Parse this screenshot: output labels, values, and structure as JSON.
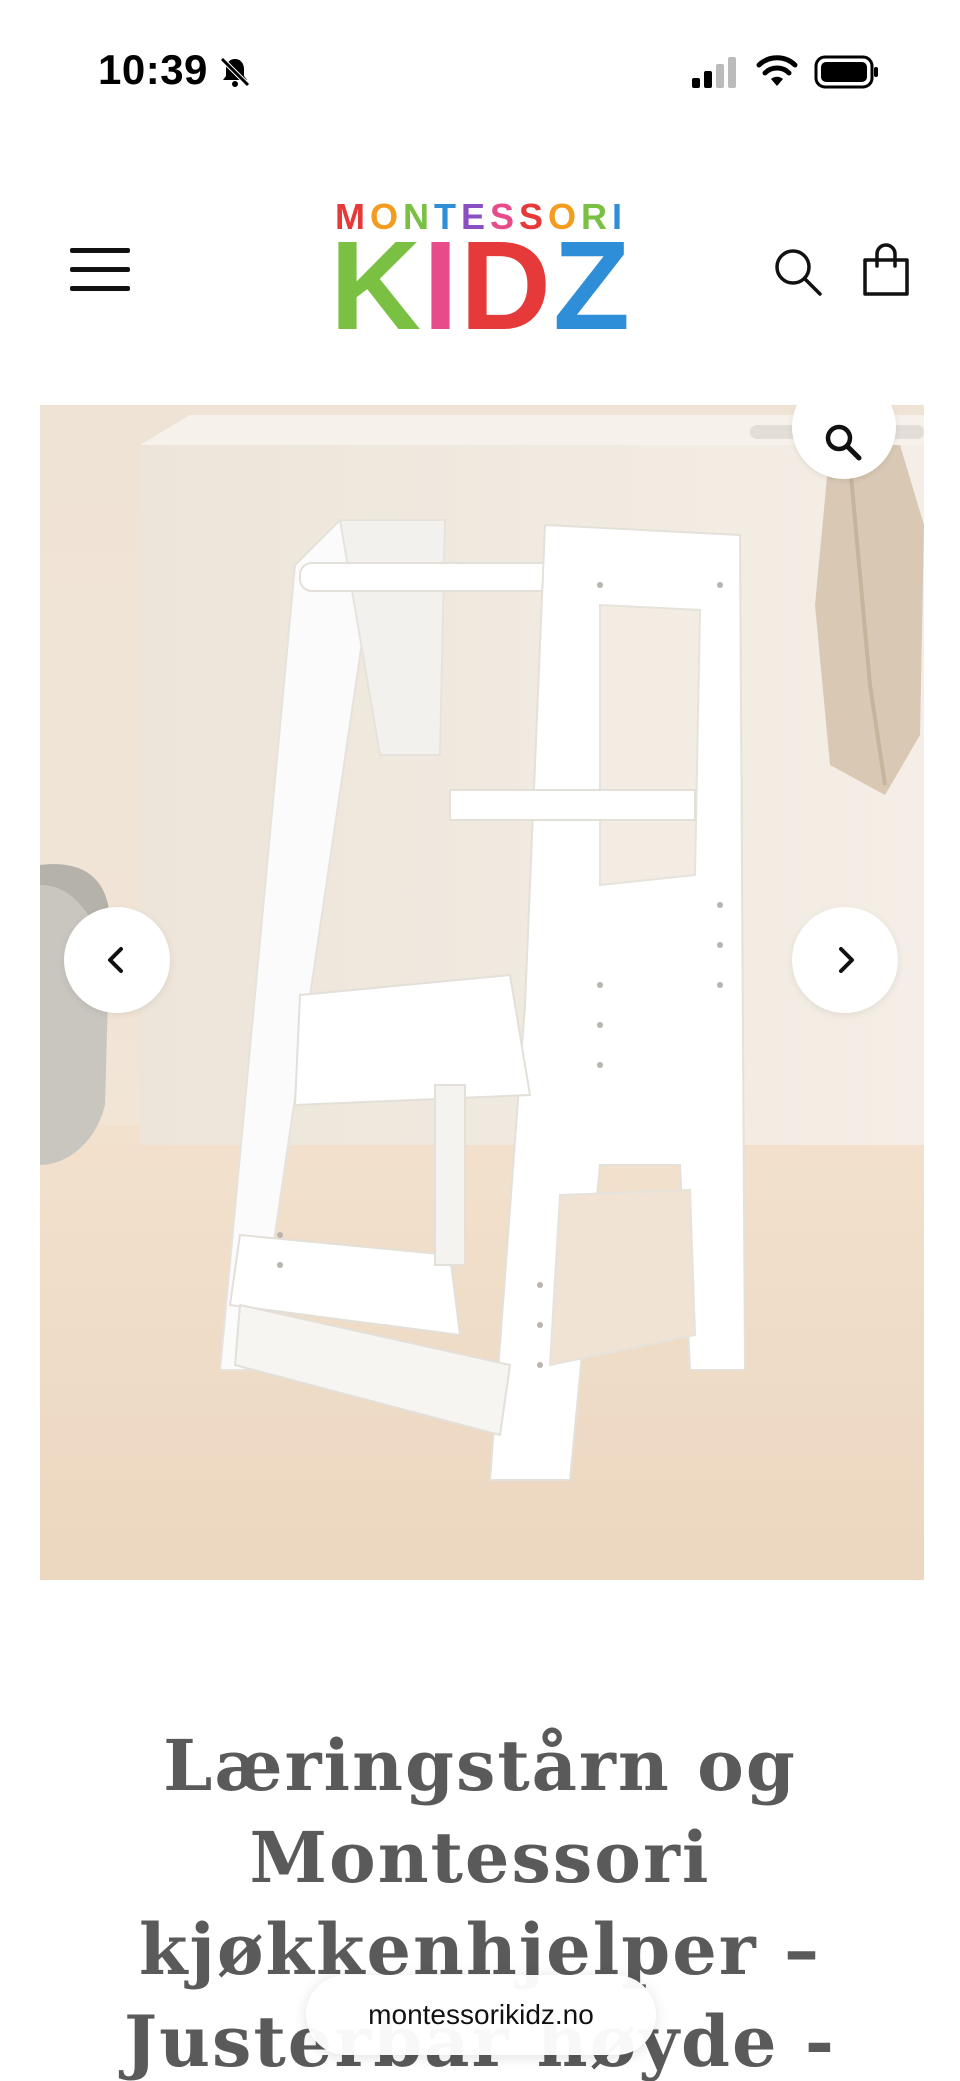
{
  "status_bar": {
    "time": "10:39",
    "icons": [
      "bell-slash-icon",
      "cellular-signal-icon",
      "wifi-icon",
      "battery-icon"
    ]
  },
  "header": {
    "logo_top": "MONTESSORI",
    "logo_bottom": "KIDZ",
    "logo_colors": [
      "#e63a3a",
      "#f39c1f",
      "#7ac143",
      "#2f8ed8",
      "#8a4fc2",
      "#e84b8a"
    ],
    "icons": [
      "hamburger-menu-icon",
      "search-icon",
      "shopping-bag-icon"
    ]
  },
  "gallery": {
    "icons": [
      "zoom-icon",
      "chevron-left-icon",
      "chevron-right-icon"
    ]
  },
  "product": {
    "title": "Læringstårn og Montessori kjøkkenhjelper – Justerbar høyde - Hvit"
  },
  "browser": {
    "url": "montessorikidz.no"
  }
}
